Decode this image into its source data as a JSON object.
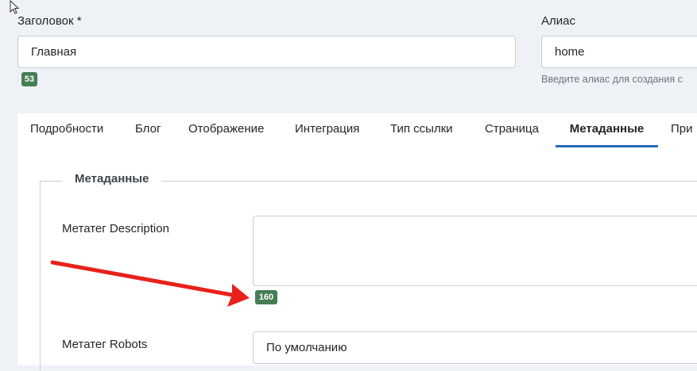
{
  "title_field": {
    "label": "Заголовок *",
    "value": "Главная",
    "char_count": "53"
  },
  "alias_field": {
    "label": "Алиас",
    "value": "home",
    "hint": "Введите алиас для создания с"
  },
  "tabs": [
    {
      "label": "Подробности"
    },
    {
      "label": "Блог"
    },
    {
      "label": "Отображение"
    },
    {
      "label": "Интеграция"
    },
    {
      "label": "Тип ссылки"
    },
    {
      "label": "Страница"
    },
    {
      "label": "Метаданные",
      "active": true
    },
    {
      "label": "При"
    }
  ],
  "metadata": {
    "legend": "Метаданные",
    "description_label": "Метатег Description",
    "description_value": "",
    "description_count": "160",
    "robots_label": "Метатег Robots",
    "robots_value": "По умолчанию"
  },
  "colors": {
    "badge": "#457d54",
    "active_tab_underline": "#2a69b8",
    "arrow": "#e8211b"
  },
  "icons": [
    "mouse-pointer-icon",
    "red-arrow-annotation"
  ]
}
